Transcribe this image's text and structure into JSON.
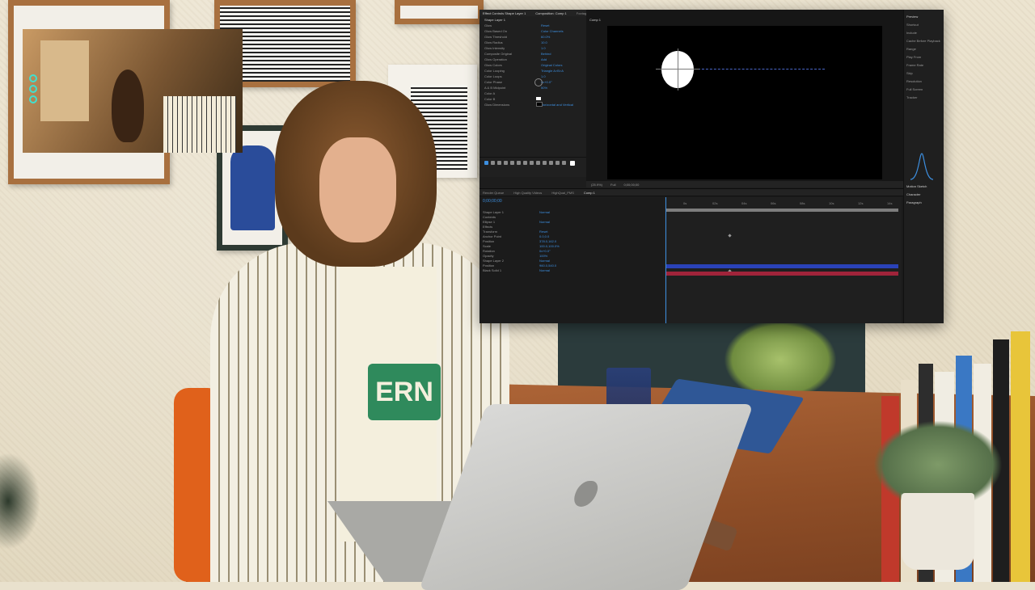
{
  "scene": {
    "tee_text": "ERN"
  },
  "webcam": {
    "icon_names": [
      "circle-icon",
      "circle-icon",
      "circle-icon"
    ]
  },
  "ae": {
    "top_tabs": [
      "Effect Controls Shape Layer 1",
      "Composition: Comp 1",
      "Footage (none)",
      "Layer (none)"
    ],
    "effect_controls": {
      "header": "Shape Layer 1",
      "rows": [
        {
          "label": "Glow",
          "value": "Reset"
        },
        {
          "label": "Glow Based On",
          "value": "Color Channels"
        },
        {
          "label": "Glow Threshold",
          "value": "60.0%"
        },
        {
          "label": "Glow Radius",
          "value": "10.0"
        },
        {
          "label": "Glow Intensity",
          "value": "1.0"
        },
        {
          "label": "Composite Original",
          "value": "Behind"
        },
        {
          "label": "Glow Operation",
          "value": "Add"
        },
        {
          "label": "Glow Colors",
          "value": "Original Colors"
        },
        {
          "label": "Color Looping",
          "value": "Triangle A>B>A"
        },
        {
          "label": "Color Loops",
          "value": "1.0"
        },
        {
          "label": "Color Phase",
          "value": "0x+0.0°"
        },
        {
          "label": "A & B Midpoint",
          "value": "50%"
        },
        {
          "label": "Color A",
          "value": ""
        },
        {
          "label": "Color B",
          "value": ""
        },
        {
          "label": "Glow Dimensions",
          "value": "Horizontal and Vertical"
        }
      ]
    },
    "viewer_tab": "Comp 1",
    "viewer_bar": [
      "(25.9%)",
      "Full",
      "0;00;00;00"
    ],
    "timeline_tabs": [
      "Render Queue",
      "High Quality Videos",
      "HighQual_PMS",
      "Comp 1"
    ],
    "timecode": "0;00;00;00",
    "layers": [
      {
        "label": "Shape Layer 1",
        "value": "Normal"
      },
      {
        "label": "Contents",
        "value": ""
      },
      {
        "label": "Ellipse 1",
        "value": "Normal"
      },
      {
        "label": "Effects",
        "value": ""
      },
      {
        "label": "Transform",
        "value": "Reset"
      },
      {
        "label": "Anchor Point",
        "value": "0.0,0.0"
      },
      {
        "label": "Position",
        "value": "378.0,162.0"
      },
      {
        "label": "Scale",
        "value": "100.0,100.0%"
      },
      {
        "label": "Rotation",
        "value": "0x+0.0°"
      },
      {
        "label": "Opacity",
        "value": "100%"
      },
      {
        "label": "Shape Layer 2",
        "value": "Normal"
      },
      {
        "label": "Position",
        "value": "960.0,540.0"
      },
      {
        "label": "Black Solid 1",
        "value": "Normal"
      }
    ],
    "ruler_ticks": [
      "0s",
      "02s",
      "04s",
      "06s",
      "08s",
      "10s",
      "12s",
      "14s"
    ],
    "right_panel": {
      "sections": [
        "Preview",
        "Shortcut",
        "Include",
        "Cache Before Playback",
        "Range",
        "Play From",
        "Frame Rate",
        "Skip",
        "Resolution",
        "Full Screen",
        "Tracker",
        "Motion Sketch",
        "Character",
        "Paragraph"
      ]
    }
  }
}
